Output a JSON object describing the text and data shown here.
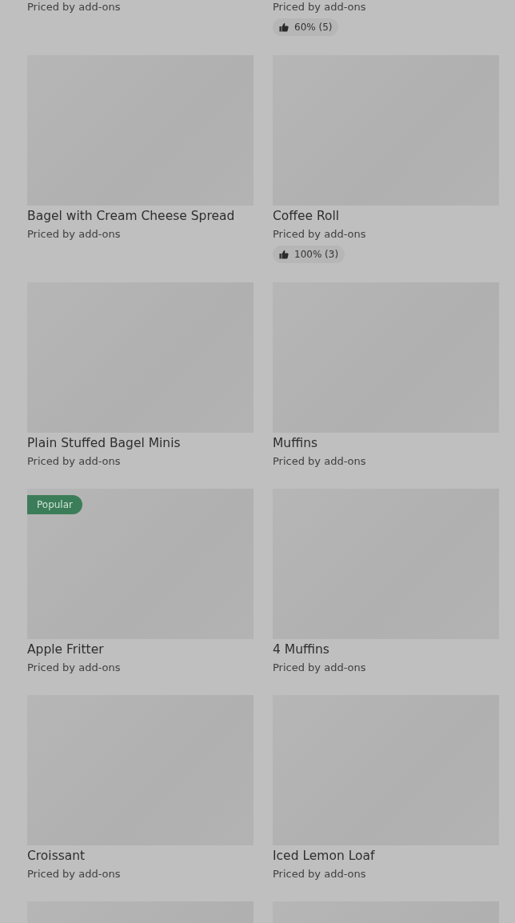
{
  "items": [
    {
      "image": false,
      "price": "Priced by add-ons"
    },
    {
      "image": false,
      "price": "Priced by add-ons",
      "rating": "60% (5)"
    },
    {
      "image": true,
      "name": "Bagel with Cream Cheese Spread",
      "price": "Priced by add-ons"
    },
    {
      "image": true,
      "name": "Coffee Roll",
      "price": "Priced by add-ons",
      "rating": "100% (3)"
    },
    {
      "image": true,
      "name": "Plain Stuffed Bagel Minis",
      "price": "Priced by add-ons"
    },
    {
      "image": true,
      "name": "Muffins",
      "price": "Priced by add-ons"
    },
    {
      "image": true,
      "badge": "Popular",
      "name": "Apple Fritter",
      "price": "Priced by add-ons"
    },
    {
      "image": true,
      "name": "4 Muffins",
      "price": "Priced by add-ons"
    },
    {
      "image": true,
      "name": "Croissant",
      "price": "Priced by add-ons"
    },
    {
      "image": true,
      "name": "Iced Lemon Loaf",
      "price": "Priced by add-ons"
    },
    {
      "image": true
    },
    {
      "image": true
    }
  ]
}
